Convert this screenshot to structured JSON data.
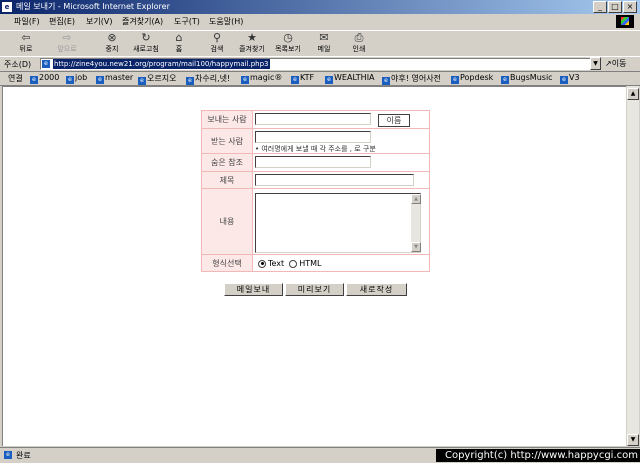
{
  "window": {
    "title": "메일 보내기 - Microsoft Internet Explorer",
    "app_icon": "ie-icon",
    "controls": [
      "_",
      "□",
      "×"
    ]
  },
  "menu": [
    "파일(F)",
    "편집(E)",
    "보기(V)",
    "즐겨찾기(A)",
    "도구(T)",
    "도움말(H)"
  ],
  "toolbar": {
    "back": "뒤로",
    "forward": "앞으로",
    "stop": "중지",
    "refresh": "새로고침",
    "home": "홈",
    "search": "검색",
    "favorites": "즐겨찾기",
    "history": "목록보기",
    "mail": "메일",
    "print": "인쇄"
  },
  "address": {
    "label": "주소(D)",
    "url": "http://zine4you.new21.org/program/mail100/happymail.php3",
    "go": "이동"
  },
  "links": {
    "label": "연결",
    "items": [
      "2000",
      "job",
      "master",
      "오르지오",
      "차수리,넷!",
      "magic®",
      "KTF",
      "WEALTHIA",
      "야후! 영어사전",
      "Popdesk",
      "BugsMusic",
      "V3"
    ]
  },
  "form": {
    "sender_label": "보내는 사람",
    "sender_value": "",
    "name_label": "이름",
    "receiver_label": "받는 사람",
    "receiver_value": "",
    "receiver_hint": "• 여러명에게 보낼 때 각 주소를 , 로 구분",
    "cc_label": "숨은 참조",
    "cc_value": "",
    "subject_label": "제목",
    "subject_value": "",
    "body_label": "내용",
    "body_value": "",
    "format_label": "형식선택",
    "format_text": "Text",
    "format_html": "HTML",
    "format_selected": "Text"
  },
  "buttons": {
    "send": "메일보내",
    "preview": "미리보기",
    "new": "새로작성"
  },
  "status": {
    "text": "완료",
    "copyright": "Copyright(c) http://www.happycgi.com"
  }
}
